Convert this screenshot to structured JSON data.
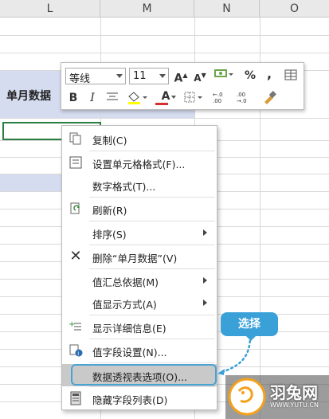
{
  "columns": [
    "L",
    "M",
    "N",
    "O"
  ],
  "cell_label": "单月数据",
  "mini_toolbar": {
    "font_name": "等线",
    "font_size": "11",
    "grow_font": "A",
    "shrink_font": "A",
    "percent": "%",
    "comma": ",",
    "bold": "B",
    "italic": "I",
    "font_color_letter": "A",
    "inc_decimal": "+.0 .00",
    "dec_decimal": ".00 +.0"
  },
  "menu": {
    "items": [
      {
        "label": "复制(C)",
        "icon": "copy-icon"
      },
      {
        "label": "设置单元格格式(F)...",
        "icon": "format-cells-icon"
      },
      {
        "label": "数字格式(T)...",
        "icon": ""
      },
      {
        "label": "刷新(R)",
        "icon": "refresh-icon"
      },
      {
        "label": "排序(S)",
        "icon": ""
      },
      {
        "label": "删除“单月数据”(V)",
        "icon": "delete-x-icon"
      },
      {
        "label": "值汇总依据(M)",
        "icon": ""
      },
      {
        "label": "值显示方式(A)",
        "icon": ""
      },
      {
        "label": "显示详细信息(E)",
        "icon": "show-details-icon"
      },
      {
        "label": "值字段设置(N)...",
        "icon": "field-settings-icon"
      },
      {
        "label": "数据透视表选项(O)...",
        "icon": ""
      },
      {
        "label": "隐藏字段列表(D)",
        "icon": "field-list-icon"
      }
    ]
  },
  "callout": "选择",
  "watermark": {
    "brand": "羽兔网",
    "url": "WWW.YUTU.CN"
  },
  "colors": {
    "highlight_border": "#4aa3d3",
    "callout_bg": "#3aa0d8",
    "selected_cell": "#2a7e3e",
    "blue_band": "#d6dcf0"
  }
}
